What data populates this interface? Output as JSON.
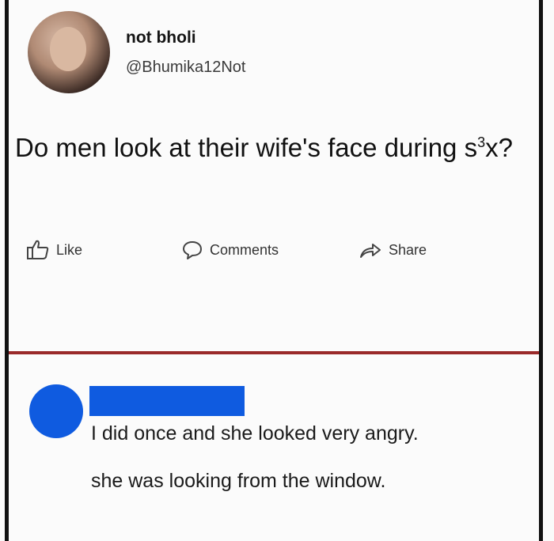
{
  "post": {
    "author_name": "not bholi",
    "author_handle": "@Bhumika12Not",
    "text_before_sup": "Do men look at their wife's face during s",
    "text_sup": "3",
    "text_after_sup": "x?"
  },
  "actions": {
    "like_label": "Like",
    "comments_label": "Comments",
    "share_label": "Share"
  },
  "comment": {
    "line1": "I did once and she looked very angry.",
    "line2": "she was looking from the window."
  },
  "colors": {
    "divider": "#9a2a2a",
    "redaction_blue": "#0f5be0"
  },
  "icons": [
    "like-icon",
    "comments-icon",
    "share-icon"
  ]
}
